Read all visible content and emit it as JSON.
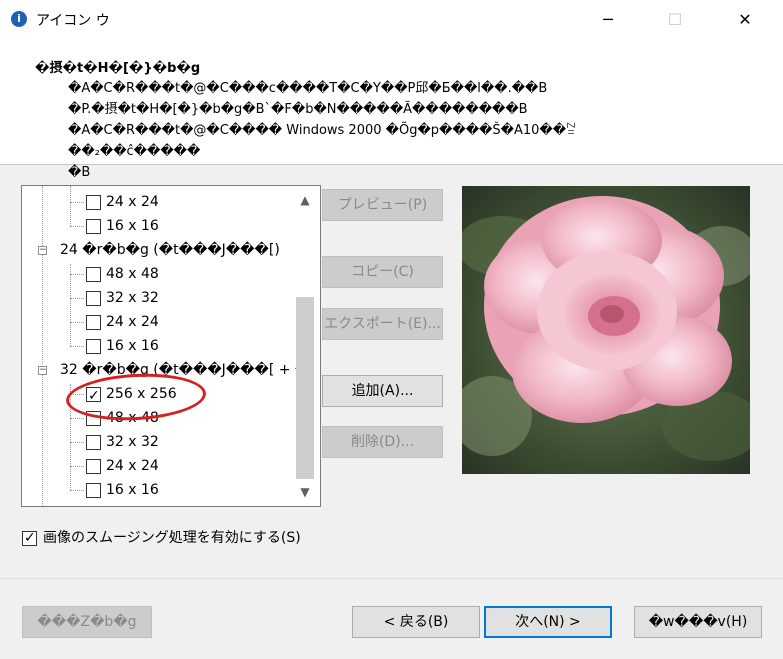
{
  "window": {
    "title": "アイコン ウ",
    "app_icon": "info-icon"
  },
  "title_controls": {
    "minimize": "─",
    "maximize": "☐",
    "close": "✕"
  },
  "header": {
    "title": "�摂�t�H�[�}�b�g",
    "description": "�A�C�R���t�@�C���c����T�C�Y��P邱�Б��l��.��B\n�P.�摂�t�H�[�}�b�g�B`�F�b�N�����Ã��������B\n�A�C�R���t�@�C���� Windows 2000 �Õg�p����Š�A10��ꊂ��₂��ĉ�����\n�B"
  },
  "tree": {
    "items": [
      {
        "label": "24 x 24",
        "checked": false,
        "level": 2
      },
      {
        "label": "16 x 16",
        "checked": false,
        "level": 2
      },
      {
        "label": "24 �r�b�g (�t���J���[)",
        "level": 1,
        "expander": "−"
      },
      {
        "label": "48 x 48",
        "checked": false,
        "level": 2
      },
      {
        "label": "32 x 32",
        "checked": false,
        "level": 2
      },
      {
        "label": "24 x 24",
        "checked": false,
        "level": 2
      },
      {
        "label": "16 x 16",
        "checked": false,
        "level": 2
      },
      {
        "label": "32 �r�b�g (�t���J���[ + �",
        "level": 1,
        "expander": "−"
      },
      {
        "label": "256 x 256",
        "checked": true,
        "level": 2
      },
      {
        "label": "48 x 48",
        "checked": false,
        "level": 2
      },
      {
        "label": "32 x 32",
        "checked": false,
        "level": 2
      },
      {
        "label": "24 x 24",
        "checked": false,
        "level": 2
      },
      {
        "label": "16 x 16",
        "checked": false,
        "level": 2
      }
    ],
    "scroll_up": "▲",
    "scroll_down": "▼"
  },
  "side_buttons": {
    "preview": "プレビュー(P)",
    "copy": "コピー(C)",
    "export": "エクスポート(E)...",
    "add": "追加(A)...",
    "delete": "削除(D)..."
  },
  "smoothing": {
    "label": "画像のスムージング処理を有効にする(S)",
    "checked": true
  },
  "footer": {
    "cancel": "���Z�b�g",
    "back": "< 戻る(B)",
    "next": "次へ(N) >",
    "help": "�w���v(H)"
  },
  "colors": {
    "accent": "#0078d7",
    "annotation": "#d62020"
  }
}
